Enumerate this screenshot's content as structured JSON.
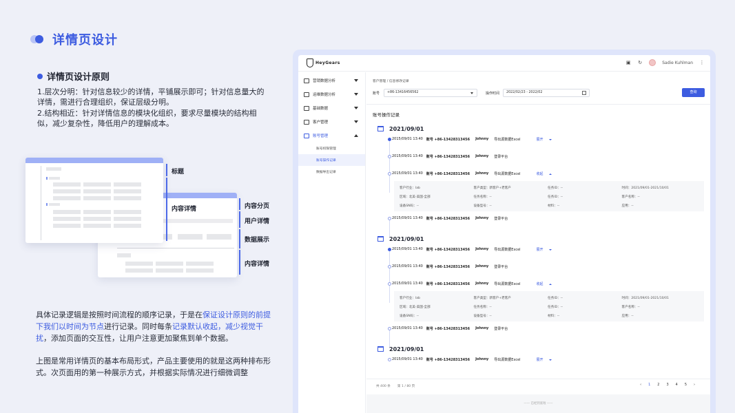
{
  "slide": {
    "title": "详情页设计",
    "section_title": "详情页设计原则",
    "principles": [
      "1.层次分明：针对信息较少的详情，平铺展示即可；针对信息量大的详情，需进行合理组织，保证层级分明。",
      "2.结构相近：针对详情信息的模块化组织，要求尽量模块的结构相似，减少复杂性，降低用户的理解成本。"
    ],
    "para1": {
      "a": "具体记录逻辑是按照时间流程的顺序记录，于是在",
      "b": "保证设计原则的前提下我们以时间为节点",
      "c": "进行记录。同时每条",
      "d": "记录默认收起，减少视觉干扰",
      "e": "，添加页面的交互性，让用户注意更加聚焦到单个数据。"
    },
    "para2": "上图是常用详情页的基本布局形式，产品主要使用的就是这两种排布形式。次页面用的第一种展示方式，并根据实际情况进行细微调整",
    "wireframe_labels": {
      "title": "标题",
      "content_detail_inner": "内容详情",
      "content_tabs": "内容分页",
      "user_detail": "用户详情",
      "data_display": "数据展示",
      "content_detail": "内容详情"
    }
  },
  "app": {
    "logo": "HeyGears",
    "user_name": "Sadie Kuhlman",
    "nav": [
      {
        "label": "营销数据分析",
        "expanded": false
      },
      {
        "label": "运维数据分析",
        "expanded": false
      },
      {
        "label": "基础数据",
        "expanded": false
      },
      {
        "label": "客户管理",
        "expanded": false
      },
      {
        "label": "账号管理",
        "expanded": true
      }
    ],
    "sub_nav": [
      "账号权限管理",
      "账号操作记录",
      "数据导出记录"
    ],
    "breadcrumb": "客户管理 / 信息修改记录",
    "filter": {
      "account_label": "账号",
      "account_value": "+86-13416456562",
      "time_label": "操作时间",
      "time_value": "2022/02/23 - 2022/02",
      "query": "查询"
    },
    "section_label": "账号操作记录",
    "groups": [
      {
        "date": "2021/09/01",
        "records": [
          {
            "time": "2015/09/01 13:40",
            "account": "账号 +86-13428313456",
            "user": "Johnny",
            "action": "导出源数据Excel",
            "toggle": "展开",
            "expanded": false,
            "active": true
          },
          {
            "time": "2015/09/01 13:40",
            "account": "账号 +86-13428313456",
            "user": "Johnny",
            "action": "登录平台",
            "toggle": "",
            "expanded": false,
            "active": false
          },
          {
            "time": "2015/09/01 13:40",
            "account": "账号 +86-13428313456",
            "user": "Johnny",
            "action": "导出源数据Excel",
            "toggle": "收起",
            "expanded": true,
            "active": false
          },
          {
            "time": "2015/09/01 13:40",
            "account": "账号 +86-13428313456",
            "user": "Johnny",
            "action": "登录平台",
            "toggle": "",
            "expanded": false,
            "active": false
          }
        ]
      },
      {
        "date": "2021/09/01",
        "records": [
          {
            "time": "2015/09/01 13:40",
            "account": "账号 +86-13428313456",
            "user": "Johnny",
            "action": "导出源数据Excel",
            "toggle": "展开",
            "expanded": false,
            "active": true
          },
          {
            "time": "2015/09/01 13:40",
            "account": "账号 +86-13428313456",
            "user": "Johnny",
            "action": "登录平台",
            "toggle": "",
            "expanded": false,
            "active": false
          },
          {
            "time": "2015/09/01 13:40",
            "account": "账号 +86-13428313456",
            "user": "Johnny",
            "action": "导出源数据Excel",
            "toggle": "收起",
            "expanded": true,
            "active": false
          },
          {
            "time": "2015/09/01 13:40",
            "account": "账号 +86-13428313456",
            "user": "Johnny",
            "action": "登录平台",
            "toggle": "",
            "expanded": false,
            "active": false
          }
        ]
      },
      {
        "date": "2021/09/01",
        "records": [
          {
            "time": "2015/09/01 13:40",
            "account": "账号 +86-13428313456",
            "user": "Johnny",
            "action": "导出源数据Excel",
            "toggle": "展开",
            "expanded": false,
            "active": false
          }
        ]
      }
    ],
    "detail_rows": [
      [
        "客户行业：lab",
        "客户类型：新客户+老客户",
        "任务ID：--",
        "时间：2021/09/01-2021/10/01"
      ],
      [
        "区域：北美-美国-全部",
        "任务名称：--",
        "任务ID：--",
        "客户名称：--"
      ],
      [
        "设备SN码：--",
        "设备型号：--",
        "材料：--",
        "应用：--"
      ]
    ],
    "footer": {
      "total": "共 400 条",
      "page_info": "第 1 / 80 页",
      "pages": [
        "‹",
        "1",
        "2",
        "3",
        "4",
        "5",
        "›"
      ],
      "end_note": "—— 已经到底啦 ——"
    }
  }
}
